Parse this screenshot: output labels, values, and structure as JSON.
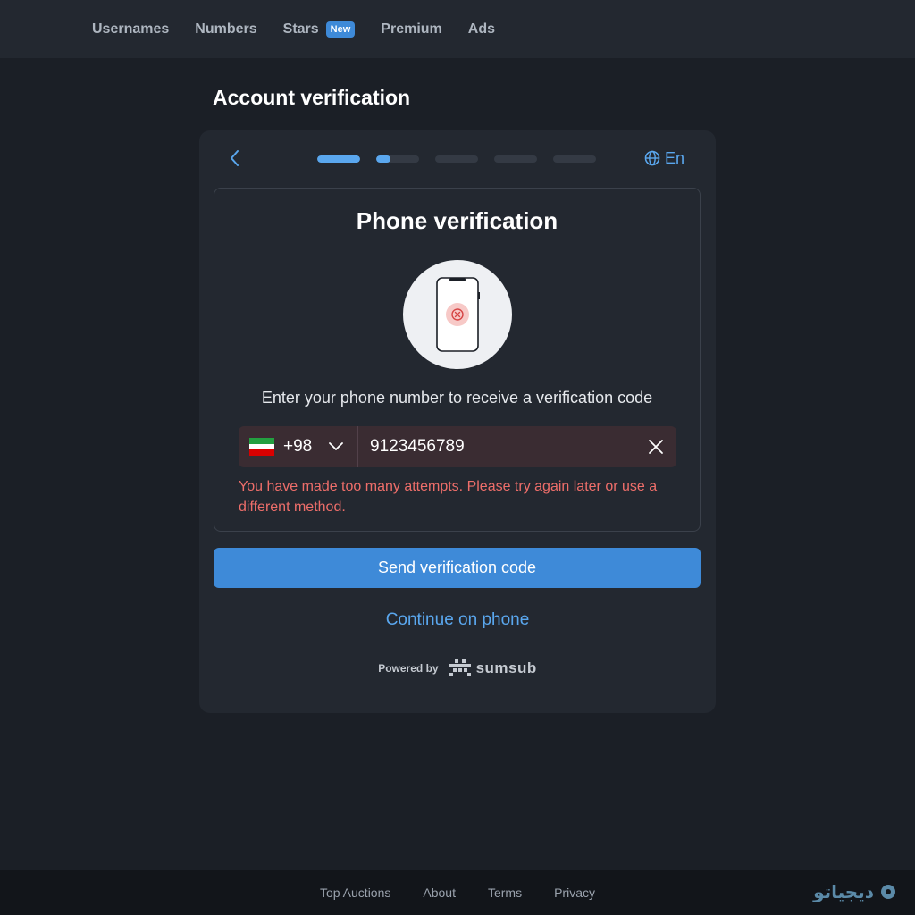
{
  "nav": {
    "items": [
      {
        "label": "Usernames"
      },
      {
        "label": "Numbers"
      },
      {
        "label": "Stars",
        "badge": "New"
      },
      {
        "label": "Premium"
      },
      {
        "label": "Ads"
      }
    ]
  },
  "page": {
    "title": "Account verification"
  },
  "card": {
    "progress_steps": [
      1.0,
      0.33,
      0,
      0,
      0
    ],
    "language": "En",
    "title": "Phone verification",
    "instruction": "Enter your phone number to receive a verification code",
    "phone": {
      "country_code": "+98",
      "value": "9123456789",
      "flag_colors": [
        "#239f40",
        "#ffffff",
        "#da0000"
      ]
    },
    "error": "You have made too many attempts. Please try again later or use a different method.",
    "send_button": "Send verification code",
    "continue_link": "Continue on phone",
    "powered_by": "Powered by",
    "brand": "sumsub"
  },
  "footer": {
    "links": [
      {
        "label": "Top Auctions"
      },
      {
        "label": "About"
      },
      {
        "label": "Terms"
      },
      {
        "label": "Privacy"
      }
    ],
    "watermark": "دیجیاتو"
  },
  "colors": {
    "accent": "#3e8ad8",
    "link": "#5aa7ee",
    "error": "#ee6e6a",
    "background": "#1b1f26",
    "card": "#232830"
  }
}
